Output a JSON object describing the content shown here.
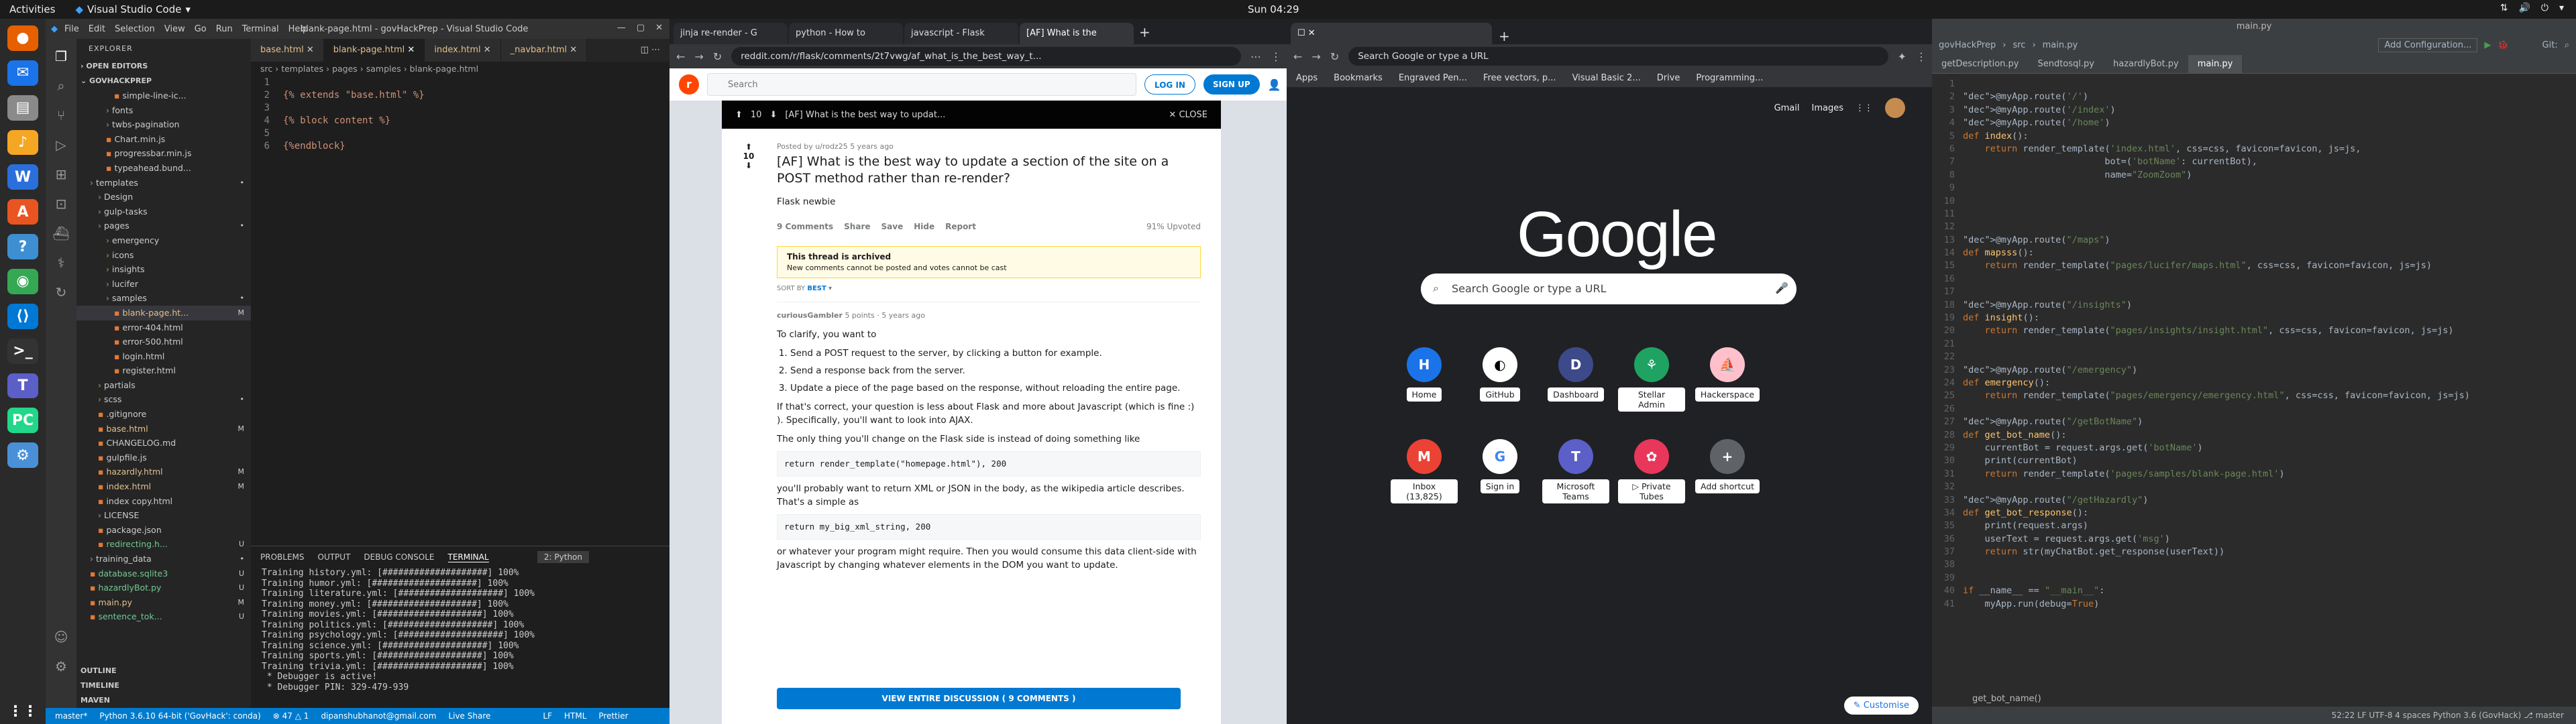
{
  "topbar": {
    "activities": "Activities",
    "app_name": "Visual Studio Code",
    "clock": "Sun 04:29"
  },
  "dock": [
    {
      "name": "firefox-icon",
      "color": "#e66000",
      "glyph": "●"
    },
    {
      "name": "thunderbird-icon",
      "color": "#1a73e8",
      "glyph": "✉"
    },
    {
      "name": "files-icon",
      "color": "#8a8a8a",
      "glyph": "▤"
    },
    {
      "name": "rhythmbox-icon",
      "color": "#f5a623",
      "glyph": "♪"
    },
    {
      "name": "writer-icon",
      "color": "#2a6fdb",
      "glyph": "W"
    },
    {
      "name": "software-icon",
      "color": "#e95420",
      "glyph": "A"
    },
    {
      "name": "help-icon",
      "color": "#3d8fd1",
      "glyph": "?"
    },
    {
      "name": "chrome-icon",
      "color": "#34a853",
      "glyph": "◉"
    },
    {
      "name": "vscode-icon",
      "color": "#0078d4",
      "glyph": "⟨⟩"
    },
    {
      "name": "terminal-icon",
      "color": "#333333",
      "glyph": ">_"
    },
    {
      "name": "teams-icon",
      "color": "#5b5fc7",
      "glyph": "T"
    },
    {
      "name": "pycharm-icon",
      "color": "#21d789",
      "glyph": "PC"
    },
    {
      "name": "settings-icon",
      "color": "#4a90d9",
      "glyph": "⚙"
    },
    {
      "name": "apps-grid-icon",
      "color": "#2a2a2a",
      "glyph": "⋮⋮"
    }
  ],
  "vscode": {
    "menu": [
      "File",
      "Edit",
      "Selection",
      "View",
      "Go",
      "Run",
      "Terminal",
      "Help"
    ],
    "window_title": "blank-page.html - govHackPrep - Visual Studio Code",
    "explorer_label": "EXPLORER",
    "open_editors": "OPEN EDITORS",
    "project": "GOVHACKPREP",
    "tree": [
      {
        "label": "simple-line-ic...",
        "indent": 4,
        "badge": ""
      },
      {
        "label": "fonts",
        "indent": 3,
        "badge": ""
      },
      {
        "label": "twbs-pagination",
        "indent": 3,
        "badge": ""
      },
      {
        "label": "Chart.min.js",
        "indent": 3,
        "badge": ""
      },
      {
        "label": "progressbar.min.js",
        "indent": 3,
        "badge": ""
      },
      {
        "label": "typeahead.bund...",
        "indent": 3,
        "badge": ""
      },
      {
        "label": "templates",
        "indent": 1,
        "badge": "•"
      },
      {
        "label": "Design",
        "indent": 2,
        "badge": ""
      },
      {
        "label": "gulp-tasks",
        "indent": 2,
        "badge": ""
      },
      {
        "label": "pages",
        "indent": 2,
        "badge": "•"
      },
      {
        "label": "emergency",
        "indent": 3,
        "badge": ""
      },
      {
        "label": "icons",
        "indent": 3,
        "badge": ""
      },
      {
        "label": "insights",
        "indent": 3,
        "badge": ""
      },
      {
        "label": "lucifer",
        "indent": 3,
        "badge": ""
      },
      {
        "label": "samples",
        "indent": 3,
        "badge": "•"
      },
      {
        "label": "blank-page.ht...",
        "indent": 4,
        "badge": "M"
      },
      {
        "label": "error-404.html",
        "indent": 4,
        "badge": ""
      },
      {
        "label": "error-500.html",
        "indent": 4,
        "badge": ""
      },
      {
        "label": "login.html",
        "indent": 4,
        "badge": ""
      },
      {
        "label": "register.html",
        "indent": 4,
        "badge": ""
      },
      {
        "label": "partials",
        "indent": 2,
        "badge": ""
      },
      {
        "label": "scss",
        "indent": 2,
        "badge": "•"
      },
      {
        "label": ".gitignore",
        "indent": 2,
        "badge": ""
      },
      {
        "label": "base.html",
        "indent": 2,
        "badge": "M"
      },
      {
        "label": "CHANGELOG.md",
        "indent": 2,
        "badge": ""
      },
      {
        "label": "gulpfile.js",
        "indent": 2,
        "badge": ""
      },
      {
        "label": "hazardly.html",
        "indent": 2,
        "badge": "M"
      },
      {
        "label": "index.html",
        "indent": 2,
        "badge": "M"
      },
      {
        "label": "index copy.html",
        "indent": 2,
        "badge": ""
      },
      {
        "label": "LICENSE",
        "indent": 2,
        "badge": ""
      },
      {
        "label": "package.json",
        "indent": 2,
        "badge": ""
      },
      {
        "label": "redirecting.h...",
        "indent": 2,
        "badge": "U"
      },
      {
        "label": "training_data",
        "indent": 1,
        "badge": "•"
      },
      {
        "label": "database.sqlite3",
        "indent": 1,
        "badge": "U"
      },
      {
        "label": "hazardlyBot.py",
        "indent": 1,
        "badge": "U"
      },
      {
        "label": "main.py",
        "indent": 1,
        "badge": "M"
      },
      {
        "label": "sentence_tok...",
        "indent": 1,
        "badge": "U"
      }
    ],
    "outline": [
      "OUTLINE",
      "TIMELINE",
      "MAVEN"
    ],
    "tabs": [
      {
        "label": "base.html",
        "active": false
      },
      {
        "label": "blank-page.html",
        "active": true
      },
      {
        "label": "index.html",
        "active": false
      },
      {
        "label": "_navbar.html",
        "active": false
      }
    ],
    "breadcrumb": "src › templates › pages › samples › blank-page.html",
    "code": [
      "",
      "{% extends \"base.html\" %}",
      "",
      "{% block content %}",
      "",
      "{%endblock}"
    ],
    "panel_tabs": [
      "PROBLEMS",
      "OUTPUT",
      "DEBUG CONSOLE",
      "TERMINAL"
    ],
    "panel_active": "TERMINAL",
    "terminal_select": "2: Python",
    "terminal": [
      "Training history.yml: [####################] 100%",
      "Training humor.yml: [####################] 100%",
      "Training literature.yml: [####################] 100%",
      "Training money.yml: [####################] 100%",
      "Training movies.yml: [####################] 100%",
      "Training politics.yml: [####################] 100%",
      "Training psychology.yml: [####################] 100%",
      "Training science.yml: [####################] 100%",
      "Training sports.yml: [####################] 100%",
      "Training trivia.yml: [####################] 100%",
      " * Debugger is active!",
      " * Debugger PIN: 329-479-939"
    ],
    "status": {
      "branch": "master*",
      "python": "Python 3.6.10 64-bit ('GovHack': conda)",
      "errors": "⊗ 47 △ 1",
      "user": "dipanshubhanot@gmail.com",
      "live": "Live Share",
      "eol": "LF",
      "lang": "HTML",
      "prettier": "Prettier"
    }
  },
  "reddit": {
    "tabs": [
      "jinja re-render - G",
      "python - How to",
      "javascript - Flask",
      "[AF] What is the"
    ],
    "url": "reddit.com/r/flask/comments/2t7vwg/af_what_is_the_best_way_t...",
    "search_placeholder": "Search",
    "login": "LOG IN",
    "signup": "SIGN UP",
    "bar_votes": "10",
    "bar_title": "[AF] What is the best way to updat...",
    "close": "CLOSE",
    "meta": "Posted by u/rodz25 5 years ago",
    "title": "[AF] What is the best way to update a section of the site on a POST method rather than re-render?",
    "flair": "Flask newbie",
    "votes": "10",
    "actions": [
      "9 Comments",
      "Share",
      "Save",
      "Hide",
      "Report"
    ],
    "upvoted": "91% Upvoted",
    "archived_title": "This thread is archived",
    "archived_sub": "New comments cannot be posted and votes cannot be cast",
    "sortby": "SORT BY",
    "sort": "BEST",
    "commenter": "curiousGambler",
    "comment_meta": "5 points · 5 years ago",
    "c_intro": "To clarify, you want to",
    "c_list": [
      "Send a POST request to the server, by clicking a button for example.",
      "Send a response back from the server.",
      "Update a piece of the page based on the response, without reloading the entire page."
    ],
    "c_p2": "If that's correct, your question is less about Flask and more about Javascript (which is fine :) ). Specifically, you'll want to look into AJAX.",
    "c_p3": "The only thing you'll change on the Flask side is instead of doing something like",
    "code1": "return render_template(\"homepage.html\"), 200",
    "c_p4": "you'll probably want to return XML or JSON in the body, as the wikipedia article describes. That's a simple as",
    "code2": "return my_big_xml_string, 200",
    "c_p5": "or whatever your program might require. Then you would consume this data client-side with Javascript by changing whatever elements in the DOM you want to update.",
    "viewall": "VIEW ENTIRE DISCUSSION ( 9 COMMENTS )"
  },
  "google": {
    "omni": "Search Google or type a URL",
    "bookmarks": [
      "Apps",
      "Bookmarks",
      "Engraved Pen...",
      "Free vectors, p...",
      "Visual Basic 2...",
      "Drive",
      "Programming..."
    ],
    "links": [
      "Gmail",
      "Images"
    ],
    "logo": "Google",
    "search_placeholder": "Search Google or type a URL",
    "tiles": [
      {
        "label": "Home",
        "glyph": "H"
      },
      {
        "label": "GitHub",
        "glyph": "◐"
      },
      {
        "label": "Dashboard",
        "glyph": "D"
      },
      {
        "label": "Stellar Admin",
        "glyph": "⚘"
      },
      {
        "label": "Hackerspace",
        "glyph": "⛵"
      },
      {
        "label": "Inbox (13,825)",
        "glyph": "M"
      },
      {
        "label": "Sign in",
        "glyph": "G"
      },
      {
        "label": "Microsoft Teams",
        "glyph": "T"
      },
      {
        "label": "▷ Private Tubes",
        "glyph": "✿"
      },
      {
        "label": "Add shortcut",
        "glyph": "+"
      }
    ],
    "customise": "Customise"
  },
  "pycharm": {
    "title": "main.py",
    "nav": [
      "govHackPrep",
      "src",
      "main.py"
    ],
    "add_config": "Add Configuration...",
    "git": "Git:",
    "tabs": [
      {
        "label": "getDescription.py",
        "active": false
      },
      {
        "label": "Sendtosql.py",
        "active": false
      },
      {
        "label": "hazardlyBot.py",
        "active": false
      },
      {
        "label": "main.py",
        "active": true
      }
    ],
    "code": [
      "",
      "@myApp.route('/')",
      "@myApp.route('/index')",
      "@myApp.route('/home')",
      "def index():",
      "    return render_template('index.html', css=css, favicon=favicon, js=js,",
      "                          bot=('botName': currentBot),",
      "                          name=\"ZoomZoom\")",
      "",
      "",
      "",
      "",
      "@myApp.route(\"/maps\")",
      "def mapsss():",
      "    return render_template(\"pages/lucifer/maps.html\", css=css, favicon=favicon, js=js)",
      "",
      "",
      "@myApp.route(\"/insights\")",
      "def insight():",
      "    return render_template(\"pages/insights/insight.html\", css=css, favicon=favicon, js=js)",
      "",
      "",
      "@myApp.route(\"/emergency\")",
      "def emergency():",
      "    return render_template(\"pages/emergency/emergency.html\", css=css, favicon=favicon, js=js)",
      "",
      "@myApp.route(\"/getBotName\")",
      "def get_bot_name():",
      "    currentBot = request.args.get('botName')",
      "    print(currentBot)",
      "    return render_template('pages/samples/blank-page.html')",
      "",
      "@myApp.route(\"/getHazardly\")",
      "def get_bot_response():",
      "    print(request.args)",
      "    userText = request.args.get('msg')",
      "    return str(myChatBot.get_response(userText))",
      "",
      "",
      "if __name__ == \"__main__\":",
      "    myApp.run(debug=True)"
    ],
    "footer_fn": "get_bot_name()",
    "status": "52:22  LF  UTF-8  4 spaces  Python 3.6 (GovHack)  ⎇ master"
  }
}
